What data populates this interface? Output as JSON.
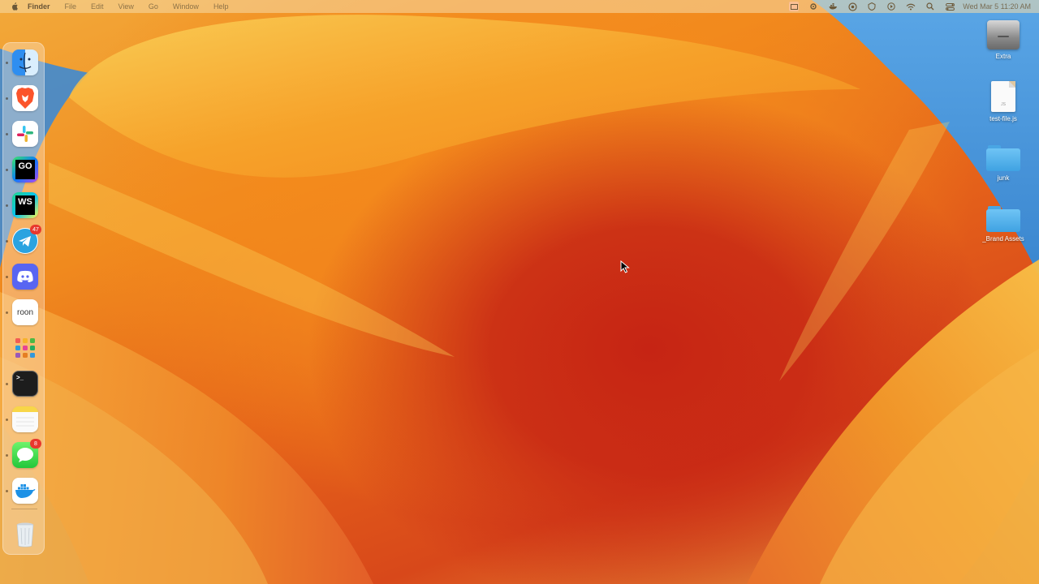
{
  "menubar": {
    "apple_icon": "apple-logo-icon",
    "app_name": "Finder",
    "menus": [
      "File",
      "Edit",
      "View",
      "Go",
      "Window",
      "Help"
    ],
    "clock": "Wed Mar 5  11:20 AM",
    "status_icons": [
      "screen-record-icon",
      "settings-icon",
      "docker-whale-icon",
      "chrome-extension-icon",
      "vpn-icon",
      "play-icon",
      "wifi-icon",
      "search-icon",
      "control-center-icon"
    ]
  },
  "dock": {
    "items": [
      {
        "name": "Finder",
        "icon": "finder-icon",
        "badge": "",
        "running": true
      },
      {
        "name": "Brave Browser",
        "icon": "brave-lion-icon",
        "badge": "",
        "running": true
      },
      {
        "name": "Slack",
        "icon": "slack-icon",
        "badge": "",
        "running": true
      },
      {
        "name": "GoLand",
        "icon": "goland-icon",
        "label": "GO",
        "badge": "",
        "running": true
      },
      {
        "name": "WebStorm",
        "icon": "webstorm-icon",
        "label": "WS",
        "badge": "",
        "running": true
      },
      {
        "name": "Telegram",
        "icon": "telegram-icon",
        "badge": "47",
        "running": true
      },
      {
        "name": "Discord",
        "icon": "discord-icon",
        "badge": "",
        "running": true
      },
      {
        "name": "Roon",
        "icon": "roon-icon",
        "label": "roon",
        "badge": "",
        "running": true
      },
      {
        "name": "Launchpad",
        "icon": "launchpad-grid-icon",
        "badge": "",
        "running": false
      },
      {
        "name": "Terminal",
        "icon": "terminal-icon",
        "label": ">_",
        "badge": "",
        "running": true
      },
      {
        "name": "Notes",
        "icon": "notes-icon",
        "badge": "",
        "running": true
      },
      {
        "name": "Messages",
        "icon": "messages-icon",
        "badge": "8",
        "running": true
      },
      {
        "name": "Docker",
        "icon": "docker-whale-icon",
        "badge": "",
        "running": true
      },
      {
        "name": "Trash",
        "icon": "trash-icon",
        "badge": "",
        "running": false
      }
    ]
  },
  "desktop_icons": [
    {
      "label": "Extra",
      "icon": "external-drive-icon"
    },
    {
      "label": "test-file.js",
      "icon": "document-icon",
      "ext": "JS"
    },
    {
      "label": "junk",
      "icon": "folder-icon"
    },
    {
      "label": "_Brand Assets",
      "icon": "folder-icon"
    }
  ],
  "colors": {
    "wallpaper_orange": "#f08a1e",
    "wallpaper_red": "#c62414",
    "wallpaper_yellow": "#f7c43c",
    "wallpaper_blue": "#3d8fd6",
    "folder_blue": "#49a6e4",
    "badge_red": "#e8382e"
  }
}
